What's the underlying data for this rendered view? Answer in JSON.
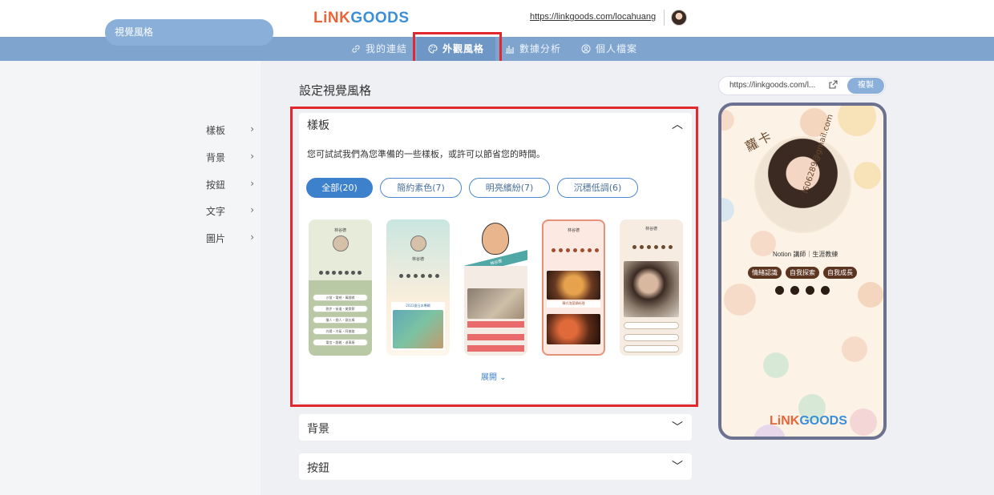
{
  "header": {
    "logo_prefix": "LiNK",
    "logo_suffix": "GOODS",
    "url": "https://linkgoods.com/locahuang"
  },
  "nav": {
    "items": [
      {
        "label": "我的連結",
        "icon": "link-icon"
      },
      {
        "label": "外觀風格",
        "icon": "palette-icon",
        "active": true
      },
      {
        "label": "數據分析",
        "icon": "bar-chart-icon"
      },
      {
        "label": "個人檔案",
        "icon": "user-circle-icon"
      }
    ]
  },
  "sidebar": {
    "active": "視覺風格",
    "items": [
      {
        "label": "樣板"
      },
      {
        "label": "背景"
      },
      {
        "label": "按鈕"
      },
      {
        "label": "文字"
      },
      {
        "label": "圖片"
      }
    ]
  },
  "main": {
    "title": "設定視覺風格",
    "template_panel": {
      "title": "樣板",
      "description": "您可試試我們為您準備的一些樣板，或許可以節省您的時間。",
      "chips": [
        {
          "label": "全部(20)",
          "active": true
        },
        {
          "label": "簡約素色(7)"
        },
        {
          "label": "明亮繽紛(7)"
        },
        {
          "label": "沉穩低調(6)"
        }
      ],
      "templates": [
        {
          "name": "林谷德",
          "buttons": [
            "沙發・電視・萬國棋",
            "跑步・街道・美食節",
            "獵人・戀人・頭太棒",
            "光陽・冷氣・阿普路",
            "電信・跟着・退車廠"
          ]
        },
        {
          "name": "林谷德",
          "caption": "2023夏日本專輯"
        },
        {
          "name": "林谷德"
        },
        {
          "name": "林谷德",
          "caption": "韓式泡菜鍋料理"
        },
        {
          "name": "林谷德"
        }
      ],
      "expand_label": "展開"
    },
    "accordions": [
      {
        "title": "背景"
      },
      {
        "title": "按鈕"
      }
    ]
  },
  "preview": {
    "url": "https://linkgoods.com/l...",
    "copy_label": "複製",
    "title": "蘿卡",
    "email": "l606289@gmail.com",
    "subtitle": "Notion 講師｜生涯教練",
    "tags": [
      "情緒認識",
      "自我探索",
      "自我成長"
    ],
    "socials": [
      "facebook-icon",
      "instagram-icon",
      "music-icon",
      "chat-icon"
    ],
    "logo_prefix": "LiNK",
    "logo_suffix": "GOODS"
  },
  "colors": {
    "accent": "#3d80cc",
    "nav_bg": "#7fa5cf",
    "highlight": "#e0282e",
    "phone_border": "#6d7190"
  }
}
